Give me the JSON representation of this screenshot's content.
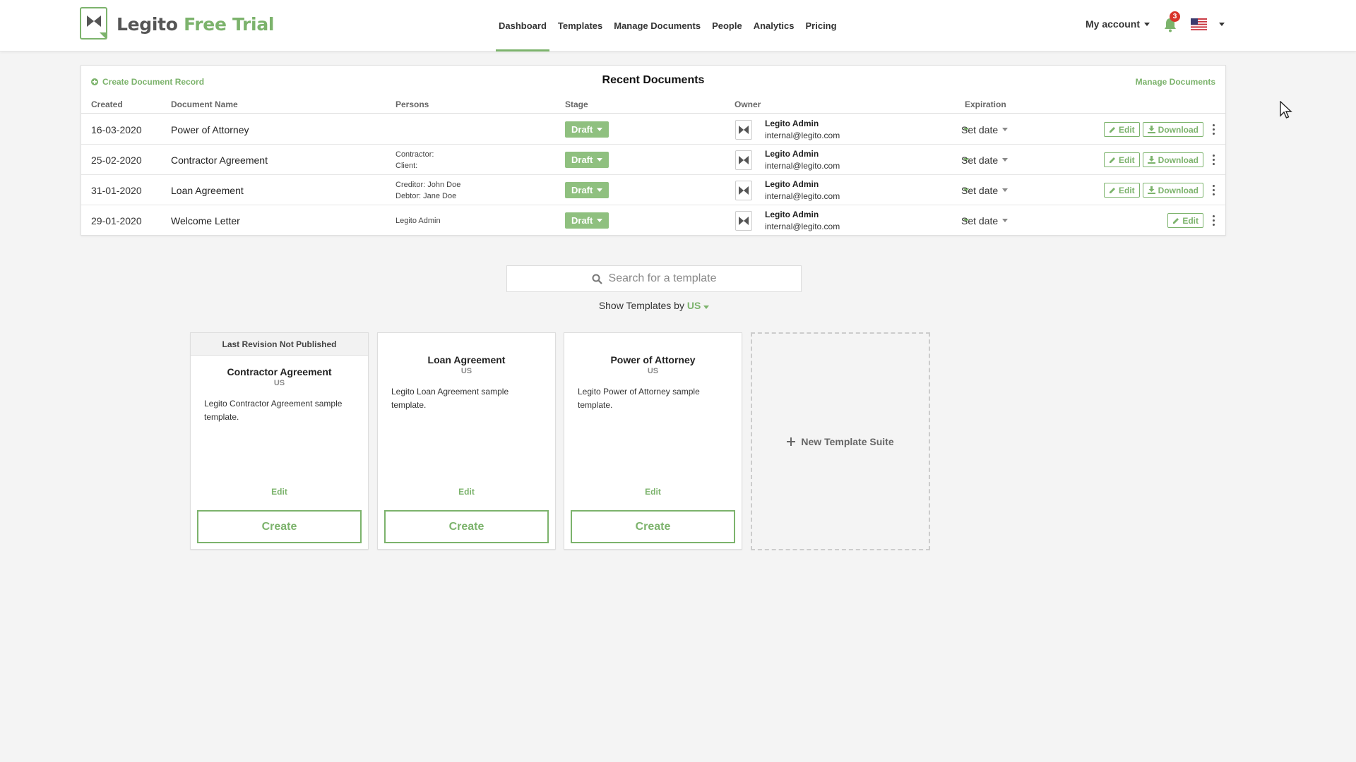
{
  "header": {
    "logo_word1": "Legito",
    "logo_word2": "Free Trial",
    "nav": [
      "Dashboard",
      "Templates",
      "Manage Documents",
      "People",
      "Analytics",
      "Pricing"
    ],
    "active_nav": "Dashboard",
    "account_label": "My account",
    "notification_count": "3",
    "language_flag": "us-flag-icon"
  },
  "docs": {
    "create_record": "Create Document Record",
    "title": "Recent Documents",
    "manage_link": "Manage Documents",
    "columns": [
      "Created",
      "Document Name",
      "Persons",
      "Stage",
      "Owner",
      "Expiration"
    ],
    "rows": [
      {
        "created": "16-03-2020",
        "name": "Power of Attorney",
        "persons": [
          "",
          ""
        ],
        "stage": "Draft",
        "owner_name": "Legito Admin",
        "owner_email": "internal@legito.com",
        "expiration": "Set date",
        "edit": "Edit",
        "download": "Download"
      },
      {
        "created": "25-02-2020",
        "name": "Contractor Agreement",
        "persons": [
          "Contractor:",
          "Client:"
        ],
        "stage": "Draft",
        "owner_name": "Legito Admin",
        "owner_email": "internal@legito.com",
        "expiration": "Set date",
        "edit": "Edit",
        "download": "Download"
      },
      {
        "created": "31-01-2020",
        "name": "Loan Agreement",
        "persons": [
          "Creditor: John Doe",
          "Debtor: Jane Doe"
        ],
        "stage": "Draft",
        "owner_name": "Legito Admin",
        "owner_email": "internal@legito.com",
        "expiration": "Set date",
        "edit": "Edit",
        "download": "Download"
      },
      {
        "created": "29-01-2020",
        "name": "Welcome Letter",
        "persons": [
          "Legito Admin",
          ""
        ],
        "stage": "Draft",
        "owner_name": "Legito Admin",
        "owner_email": "internal@legito.com",
        "expiration": "Set date",
        "edit": "Edit",
        "download": ""
      }
    ]
  },
  "search": {
    "placeholder": "Search for a template"
  },
  "show_templates": {
    "prefix": "Show Templates by",
    "value": "US"
  },
  "templates": [
    {
      "banner": "Last Revision Not Published",
      "name": "Contractor Agreement",
      "lang": "US",
      "desc": "Legito Contractor Agreement sample template.",
      "edit": "Edit",
      "create": "Create"
    },
    {
      "banner": "",
      "name": "Loan Agreement",
      "lang": "US",
      "desc": "Legito Loan Agreement sample template.",
      "edit": "Edit",
      "create": "Create"
    },
    {
      "banner": "",
      "name": "Power of Attorney",
      "lang": "US",
      "desc": "Legito Power of Attorney sample template.",
      "edit": "Edit",
      "create": "Create"
    }
  ],
  "new_suite": "New Template Suite",
  "colors": {
    "accent": "#7cb36c",
    "badge": "#d9342b",
    "stage": "#8fc07f"
  }
}
